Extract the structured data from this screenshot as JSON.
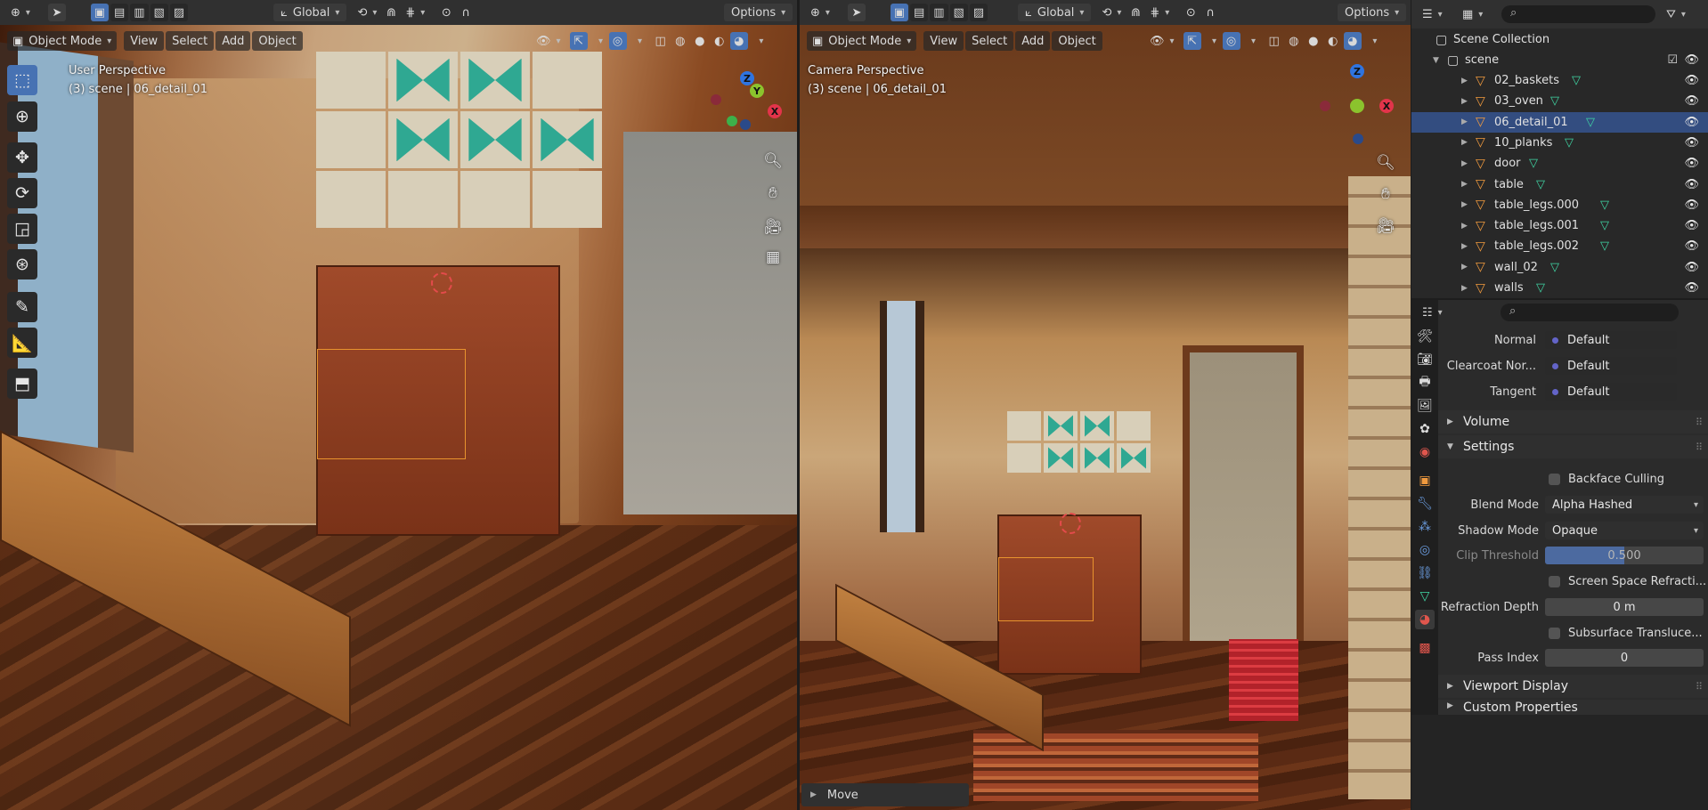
{
  "colors": {
    "accent": "#4772b3",
    "selection": "#e8932e",
    "outliner_selected": "#334d80",
    "mesh_icon": "#f09a3e",
    "data_icon": "#40d7a5"
  },
  "left_viewport": {
    "header": {
      "transform_orientation": "Global",
      "options": "Options"
    },
    "mode": "Object Mode",
    "menus": [
      "View",
      "Select",
      "Add",
      "Object"
    ],
    "perspective": "User Perspective",
    "scene_info": "(3) scene | 06_detail_01",
    "tools": [
      "select-box-tool",
      "cursor-tool",
      "move-tool",
      "rotate-tool",
      "scale-tool",
      "transform-tool",
      "annotate-tool",
      "measure-tool",
      "add-cube-tool"
    ],
    "gizmo": {
      "x": "X",
      "y": "Y",
      "z": "Z"
    }
  },
  "right_viewport": {
    "header": {
      "transform_orientation": "Global",
      "options": "Options"
    },
    "mode": "Object Mode",
    "menus": [
      "View",
      "Select",
      "Add",
      "Object"
    ],
    "perspective": "Camera Perspective",
    "scene_info": "(3) scene | 06_detail_01",
    "gizmo": {
      "x": "X",
      "z": "Z"
    },
    "operator_panel": "Move"
  },
  "outliner": {
    "root": "Scene Collection",
    "collection": "scene",
    "items": [
      {
        "name": "02_baskets",
        "selected": false
      },
      {
        "name": "03_oven",
        "selected": false
      },
      {
        "name": "06_detail_01",
        "selected": true
      },
      {
        "name": "10_planks",
        "selected": false
      },
      {
        "name": "door",
        "selected": false
      },
      {
        "name": "table",
        "selected": false
      },
      {
        "name": "table_legs.000",
        "selected": false
      },
      {
        "name": "table_legs.001",
        "selected": false
      },
      {
        "name": "table_legs.002",
        "selected": false
      },
      {
        "name": "wall_02",
        "selected": false
      },
      {
        "name": "walls",
        "selected": false
      }
    ]
  },
  "properties": {
    "sockets": [
      {
        "label": "Normal",
        "value": "Default"
      },
      {
        "label": "Clearcoat Nor...",
        "value": "Default"
      },
      {
        "label": "Tangent",
        "value": "Default"
      }
    ],
    "panels": {
      "volume": "Volume",
      "settings": "Settings",
      "viewport_display": "Viewport Display",
      "custom_properties": "Custom Properties"
    },
    "settings": {
      "backface_culling": "Backface Culling",
      "blend_mode_label": "Blend Mode",
      "blend_mode": "Alpha Hashed",
      "shadow_mode_label": "Shadow Mode",
      "shadow_mode": "Opaque",
      "clip_threshold_label": "Clip Threshold",
      "clip_threshold": "0.500",
      "screen_space_refraction": "Screen Space Refracti...",
      "refraction_depth_label": "Refraction Depth",
      "refraction_depth": "0 m",
      "subsurface_translucency": "Subsurface Transluce...",
      "pass_index_label": "Pass Index",
      "pass_index": "0"
    }
  }
}
